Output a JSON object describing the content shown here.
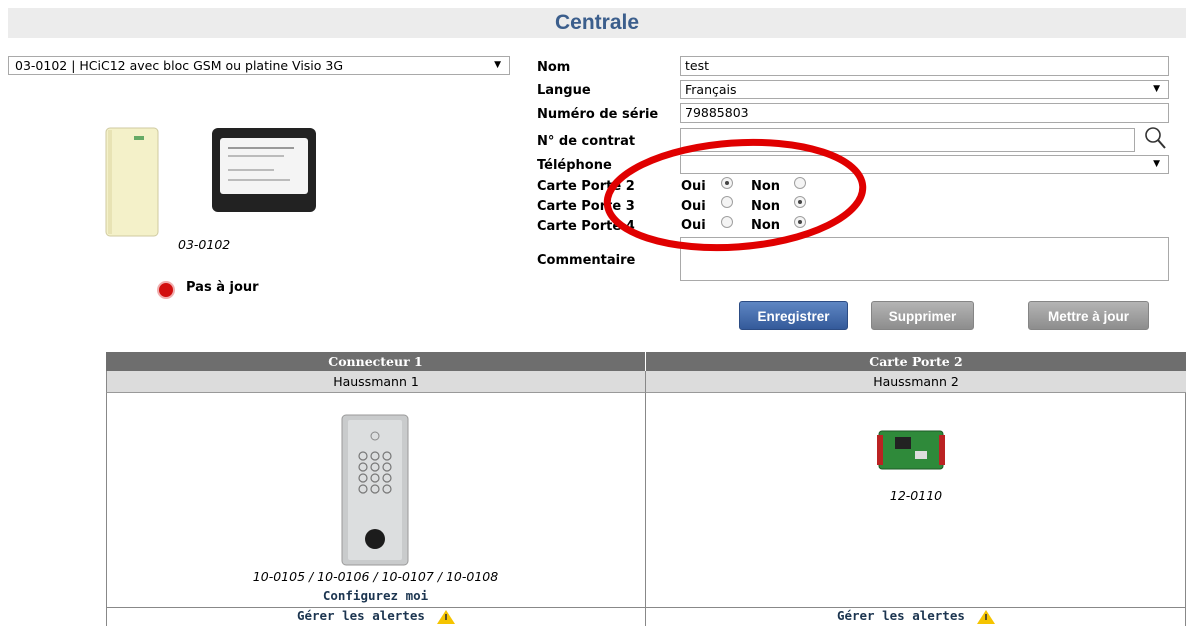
{
  "page": {
    "title": "Centrale"
  },
  "model": {
    "selected": "03-0102 | HCiC12 avec bloc GSM ou platine Visio 3G",
    "reference": "03-0102"
  },
  "status": {
    "label": "Pas à jour",
    "color": "#d20f0f"
  },
  "form": {
    "nom_label": "Nom",
    "nom_value": "test",
    "langue_label": "Langue",
    "langue_value": "Français",
    "serie_label": "Numéro de série",
    "serie_value": "79885803",
    "contrat_label": "N° de contrat",
    "contrat_value": "",
    "telephone_label": "Téléphone",
    "telephone_value": "",
    "commentaire_label": "Commentaire",
    "commentaire_value": "",
    "oui": "Oui",
    "non": "Non",
    "cartes": [
      {
        "label": "Carte Porte 2",
        "selected": "Oui"
      },
      {
        "label": "Carte Porte 3",
        "selected": "Non"
      },
      {
        "label": "Carte Porte 4",
        "selected": "Non"
      }
    ]
  },
  "buttons": {
    "save": "Enregistrer",
    "delete": "Supprimer",
    "update": "Mettre à jour"
  },
  "table": {
    "columns": [
      {
        "header": "Connecteur 1",
        "name": "Haussmann 1",
        "ref": "10-0105 / 10-0106 / 10-0107 / 10-0108",
        "configure": "Configurez moi",
        "alerts": "Gérer les alertes"
      },
      {
        "header": "Carte Porte 2",
        "name": "Haussmann 2",
        "ref": "12-0110",
        "alerts": "Gérer les alertes"
      }
    ]
  },
  "colors": {
    "accent": "#3b5e8c",
    "annotation": "#e00000"
  },
  "icons": [
    "search-icon",
    "warning-icon",
    "chevron-down-icon"
  ]
}
